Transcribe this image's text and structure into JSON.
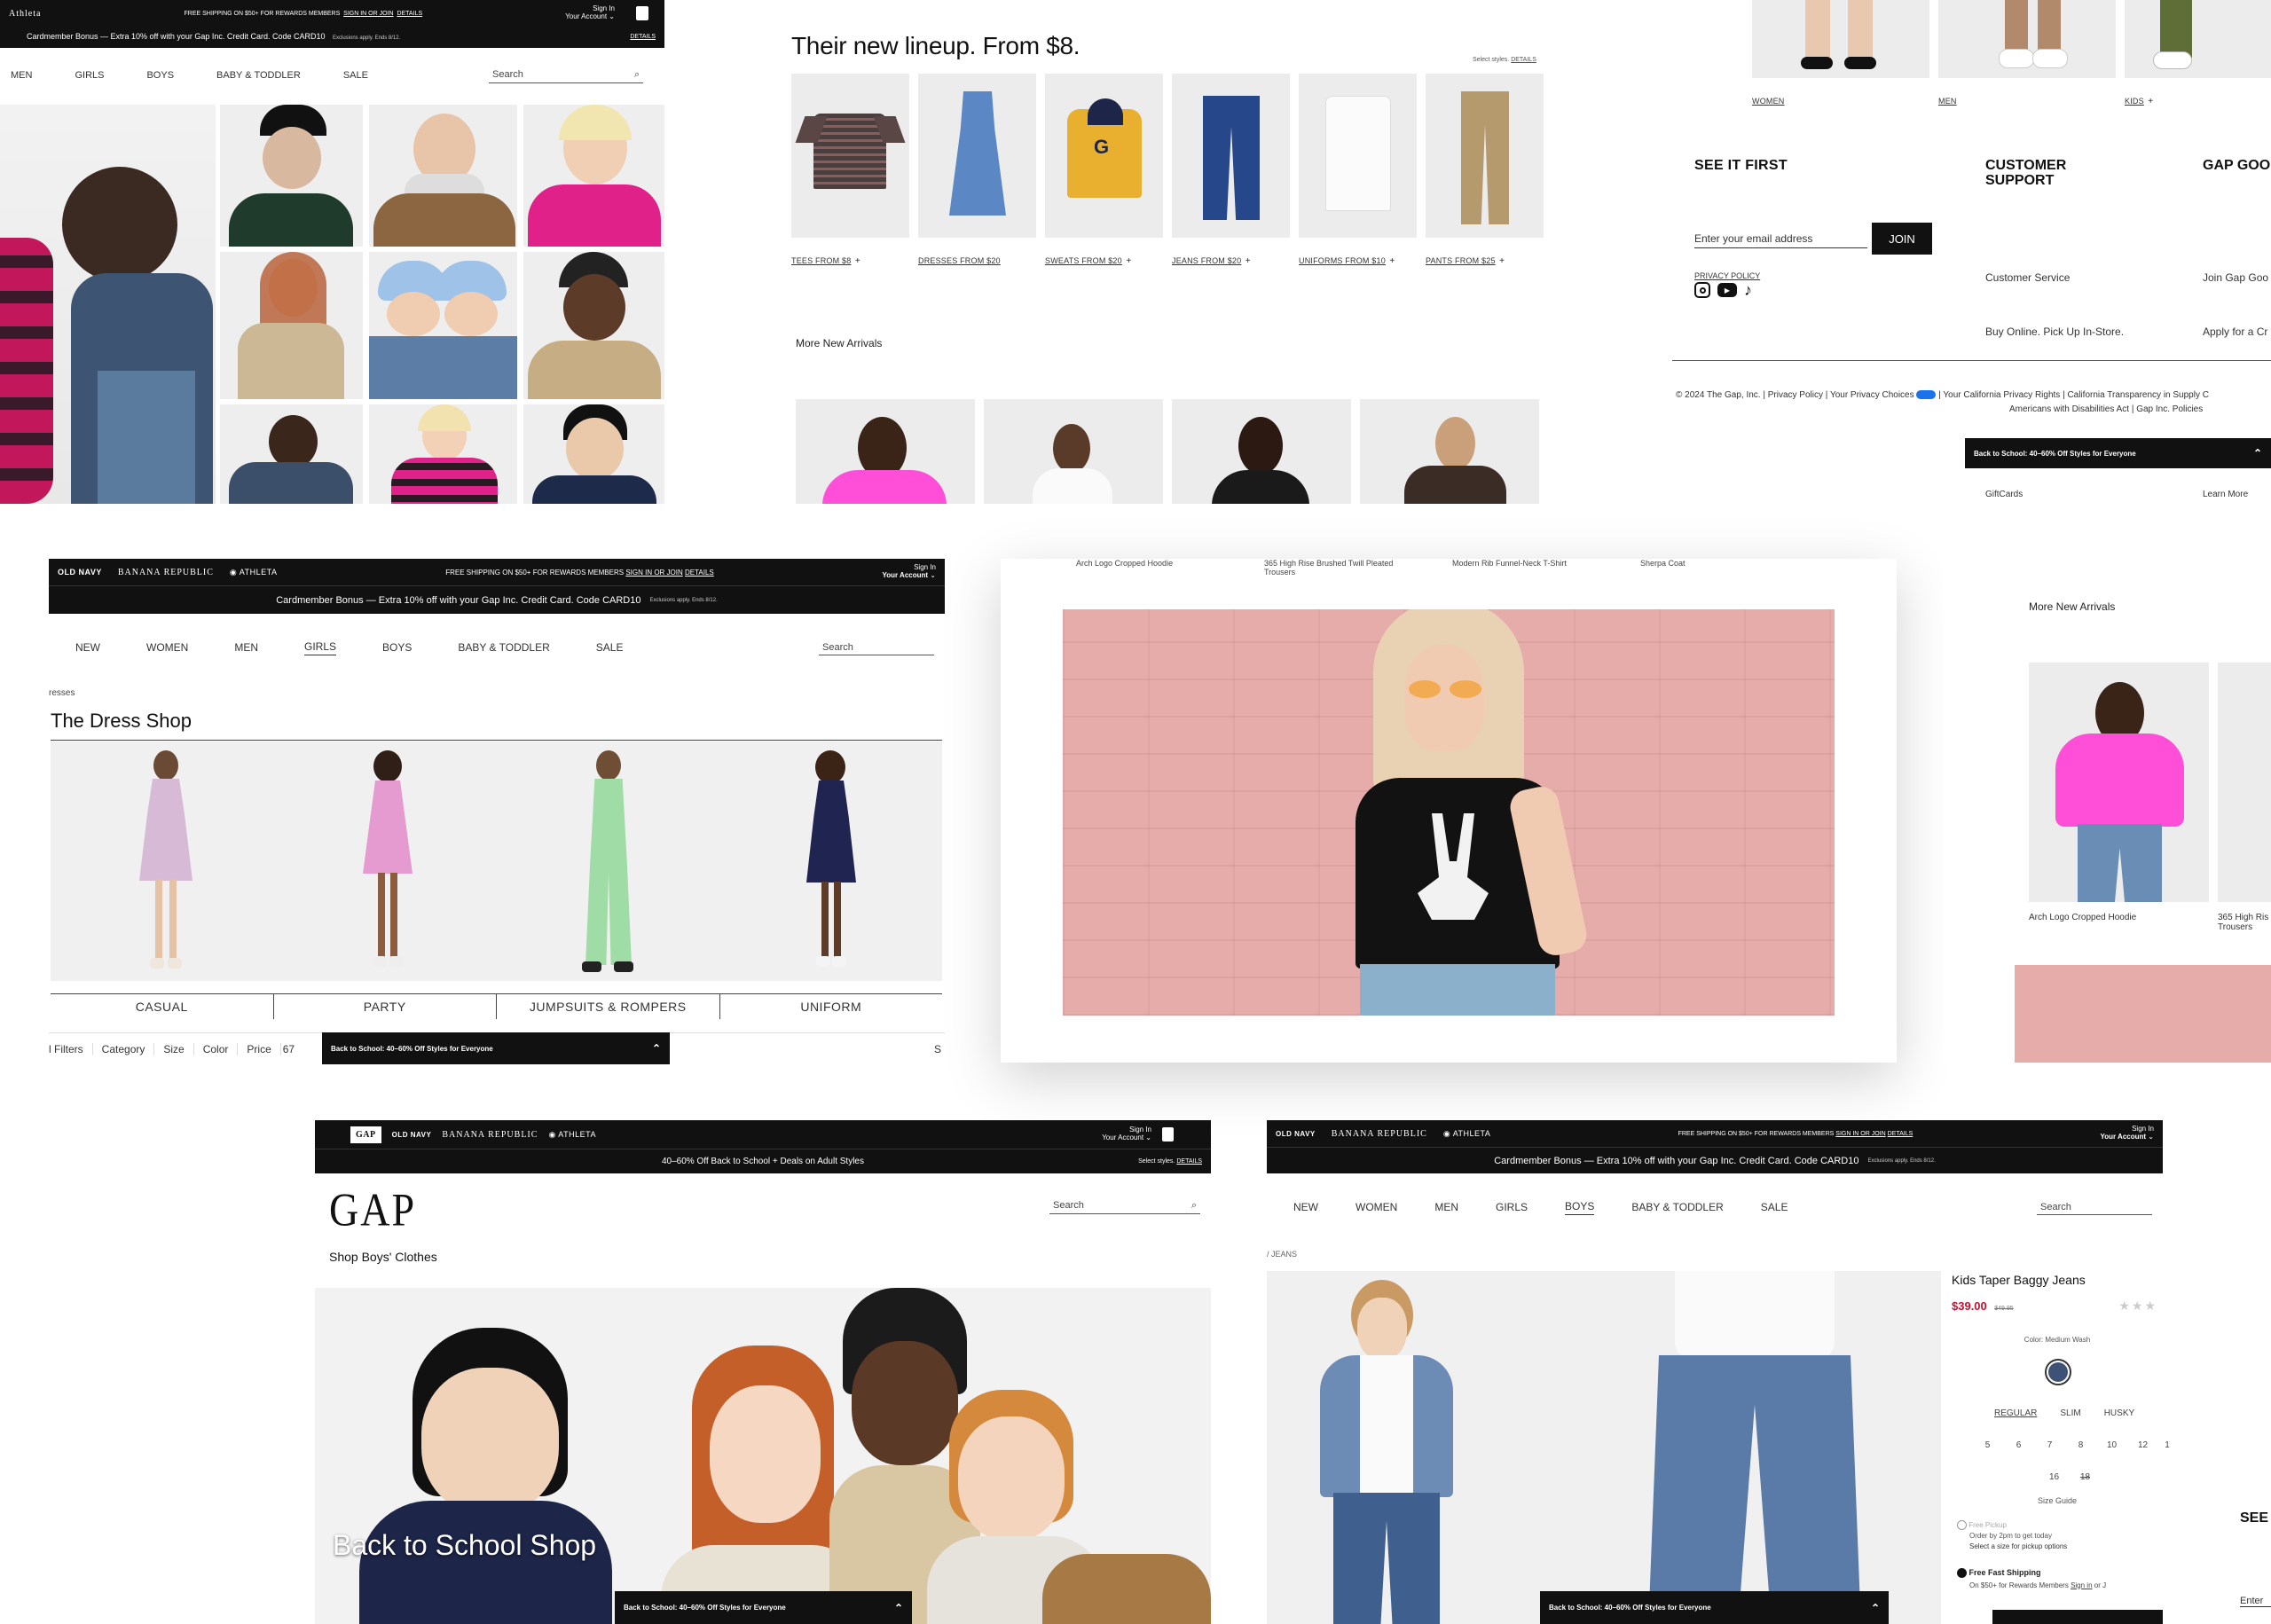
{
  "colors": {
    "black": "#111111",
    "sale_red": "#c8102e",
    "link_blue": "#1a4fa0",
    "hoodie_pink": "#ff4fd8"
  },
  "panel1": {
    "brand": "Athleta",
    "shipping": "FREE SHIPPING ON $50+ FOR REWARDS MEMBERS",
    "signin_link": "SIGN IN OR JOIN",
    "details": "DETAILS",
    "account_top": "Sign In",
    "account": "Your Account",
    "bag_icon": "shopping-bag-icon",
    "cardmember": "Cardmember Bonus — Extra 10% off with your Gap Inc. Credit Card. Code CARD10",
    "exclusions": "Exclusions apply. Ends 8/12.",
    "details2": "DETAILS",
    "nav": [
      "MEN",
      "GIRLS",
      "BOYS",
      "BABY & TODDLER",
      "SALE"
    ],
    "search_placeholder": "Search",
    "search_icon": "search-icon"
  },
  "panel2": {
    "heading": "Their new lineup. From $8.",
    "select_styles": "Select styles.",
    "details": "DETAILS",
    "products": [
      {
        "label": "TEES FROM $8"
      },
      {
        "label": "DRESSES FROM $20"
      },
      {
        "label": "SWEATS FROM $20"
      },
      {
        "label": "JEANS FROM $20"
      },
      {
        "label": "UNIFORMS FROM $10"
      },
      {
        "label": "PANTS FROM $25"
      }
    ],
    "more_new_arrivals": "More New Arrivals"
  },
  "panel3": {
    "categories": [
      "WOMEN",
      "MEN",
      "KIDS"
    ],
    "see_it_first": "SEE IT FIRST",
    "email_placeholder": "Enter your email address",
    "join": "JOIN",
    "privacy_policy": "PRIVACY POLICY",
    "customer_support": "CUSTOMER SUPPORT",
    "customer_service": "Customer Service",
    "buy_online": "Buy Online. Pick Up In-Store.",
    "gap_good_rewards": "GAP GOOD REWARDS",
    "join_gap_good": "Join Gap Goo",
    "apply_for": "Apply for a Cr",
    "copyright": "© 2024 The Gap, Inc. | Privacy Policy | Your Privacy Choices",
    "copyright2": "| Your California Privacy Rights | California Transparency in Supply C",
    "copyright3": "Americans with Disabilities Act | Gap Inc. Policies",
    "back_to_school": "Back to School: 40–60% Off Styles for Everyone",
    "giftcards": "GiftCards",
    "learn_more": "Learn More"
  },
  "panel4": {
    "brands": [
      "OLD NAVY",
      "BANANA REPUBLIC",
      "ATHLETA"
    ],
    "shipping": "FREE SHIPPING ON $50+ FOR REWARDS MEMBERS",
    "signin_link": "SIGN IN OR JOIN",
    "details": "DETAILS",
    "account_top": "Sign In",
    "account": "Your Account",
    "cardmember": "Cardmember Bonus — Extra 10% off with your Gap Inc. Credit Card. Code CARD10",
    "exclusions": "Exclusions apply. Ends 8/12.",
    "nav": [
      "NEW",
      "WOMEN",
      "MEN",
      "GIRLS",
      "BOYS",
      "BABY & TODDLER",
      "SALE"
    ],
    "active_nav": "GIRLS",
    "search_placeholder": "Search",
    "breadcrumb": "resses",
    "title": "The Dress Shop",
    "categories": [
      "CASUAL",
      "PARTY",
      "JUMPSUITS & ROMPERS",
      "UNIFORM"
    ],
    "filters": [
      "l Filters",
      "Category",
      "Size",
      "Color",
      "Price",
      "67"
    ],
    "back_to_school": "Back to School: 40–60% Off Styles for Everyone",
    "sort_initial": "S"
  },
  "panel5": {
    "product_labels": [
      "Arch Logo Cropped Hoodie",
      "365 High Rise Brushed Twill Pleated Trousers",
      "Modern Rib Funnel-Neck T-Shirt",
      "Sherpa Coat"
    ]
  },
  "panel6": {
    "more_new_arrivals": "More New Arrivals",
    "items": [
      {
        "label": "Arch Logo Cropped Hoodie"
      },
      {
        "label": "365 High Ris Trousers"
      }
    ]
  },
  "panel7": {
    "gap_logo_small": "GAP",
    "brands": [
      "OLD NAVY",
      "BANANA REPUBLIC",
      "ATHLETA"
    ],
    "account_top": "Sign In",
    "account": "Your Account",
    "promo": "40–60% Off Back to School + Deals on Adult Styles",
    "select_styles": "Select styles.",
    "details": "DETAILS",
    "logo": "GAP",
    "search_placeholder": "Search",
    "subtitle": "Shop Boys' Clothes",
    "hero_text": "Back to School Shop",
    "back_to_school": "Back to School: 40–60% Off Styles for Everyone"
  },
  "panel8": {
    "brands": [
      "OLD NAVY",
      "BANANA REPUBLIC",
      "ATHLETA"
    ],
    "shipping": "FREE SHIPPING ON $50+ FOR REWARDS MEMBERS",
    "signin_link": "SIGN IN OR JOIN",
    "details": "DETAILS",
    "account_top": "Sign In",
    "account": "Your Account",
    "cardmember": "Cardmember Bonus — Extra 10% off with your Gap Inc. Credit Card. Code CARD10",
    "exclusions": "Exclusions apply. Ends 8/12.",
    "nav": [
      "NEW",
      "WOMEN",
      "MEN",
      "GIRLS",
      "BOYS",
      "BABY & TODDLER",
      "SALE"
    ],
    "active_nav": "BOYS",
    "search_placeholder": "Search",
    "breadcrumb": "/ JEANS",
    "product_name": "Kids Taper Baggy Jeans",
    "price": "$39.00",
    "old_price": "$49.95",
    "rating_stars": 3,
    "color_label": "Color: Medium Wash",
    "fits": [
      "REGULAR",
      "SLIM",
      "HUSKY"
    ],
    "active_fit": "REGULAR",
    "sizes": [
      "5",
      "6",
      "7",
      "8",
      "10",
      "12",
      "1"
    ],
    "sizes2": [
      "16",
      "18"
    ],
    "size_guide": "Size Guide",
    "free_pickup": "Free Pickup",
    "order_by": "Order by 2pm to get today",
    "select_size": "Select a size for pickup options",
    "free_fast_shipping": "Free Fast Shipping",
    "shipping_note": "On $50+ for Rewards Members",
    "sign_in": "Sign in",
    "or_j": "or J",
    "back_to_school": "Back to School: 40–60% Off Styles for Everyone",
    "see": "SEE",
    "enter": "Enter"
  }
}
